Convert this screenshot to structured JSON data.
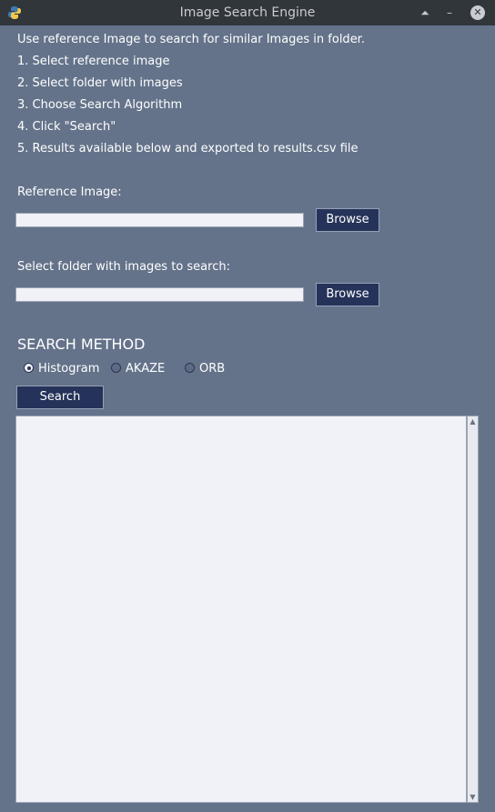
{
  "window": {
    "title": "Image Search Engine"
  },
  "instructions": [
    "Use reference Image to search for similar Images in folder.",
    "1. Select reference image",
    "2. Select folder with images",
    "3. Choose Search Algorithm",
    "4. Click \"Search\"",
    "5. Results available below and exported to results.csv file"
  ],
  "reference": {
    "label": "Reference Image:",
    "value": "",
    "browse_label": "Browse"
  },
  "folder": {
    "label": "Select folder with images to search:",
    "value": "",
    "browse_label": "Browse"
  },
  "search_method": {
    "heading": "SEARCH METHOD",
    "options": [
      "Histogram",
      "AKAZE",
      "ORB"
    ],
    "selected": "Histogram"
  },
  "search_button": "Search",
  "results": {
    "text": ""
  },
  "colors": {
    "background": "#64738a",
    "titlebar": "#31363b",
    "button": "#25335a",
    "entry": "#f0f2f7"
  },
  "icons": [
    "python-icon",
    "keep-above-icon",
    "minimize-icon",
    "close-icon",
    "scroll-up-icon",
    "scroll-down-icon"
  ]
}
